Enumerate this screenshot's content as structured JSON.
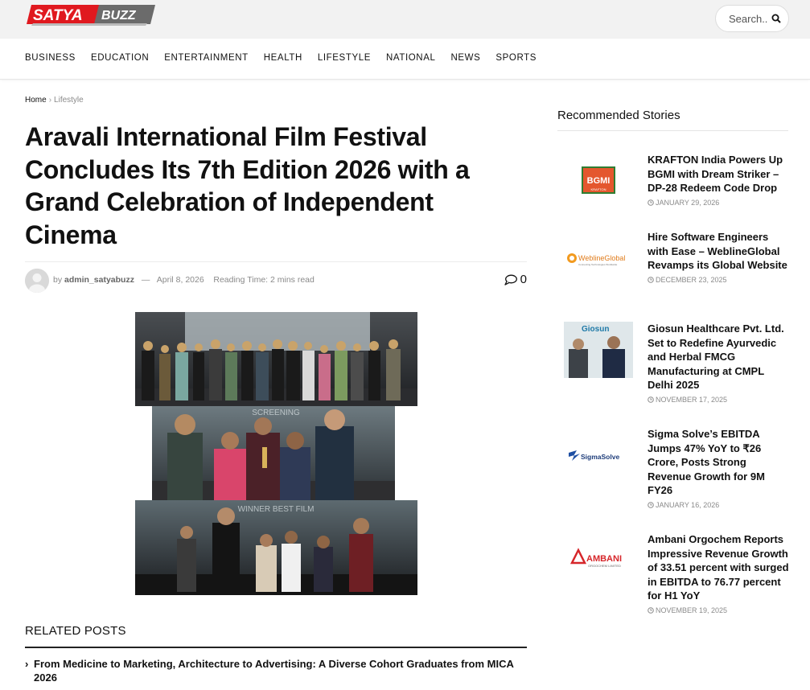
{
  "brand": {
    "logo_left": "SATYA",
    "logo_right": "BUZZ",
    "accent_red": "#e0191f",
    "accent_dark": "#555555"
  },
  "search": {
    "label": "Search..",
    "icon": "search-icon"
  },
  "nav": {
    "items": [
      "BUSINESS",
      "EDUCATION",
      "ENTERTAINMENT",
      "HEALTH",
      "LIFESTYLE",
      "NATIONAL",
      "NEWS",
      "SPORTS"
    ]
  },
  "breadcrumb": {
    "home": "Home",
    "separator": "›",
    "current": "Lifestyle"
  },
  "article": {
    "title": "Aravali International Film Festival Concludes Its 7th Edition 2026 with a Grand Celebration of Independent Cinema",
    "by": "by",
    "author": "admin_satyabuzz",
    "dash": "—",
    "date": "April 8, 2026",
    "reading_time": "Reading Time: 2 mins read",
    "comment_count": "0",
    "collage_banner_mid": "SCREENING",
    "collage_banner_bottom": "WINNER  BEST FILM"
  },
  "related": {
    "heading": "RELATED POSTS",
    "items": [
      {
        "title": "From Medicine to Marketing, Architecture to Advertising: A Diverse Cohort Graduates from MICA 2026"
      }
    ]
  },
  "sidebar": {
    "heading": "Recommended Stories",
    "stories": [
      {
        "title": "KRAFTON India Powers Up BGMI with Dream Striker – DP-28 Redeem Code Drop",
        "date": "JANUARY 29, 2026",
        "thumb_text": "BGMI",
        "thumb_sub": "KRAFTON"
      },
      {
        "title": "Hire Software Engineers with Ease – WeblineGlobal Revamps its Global Website",
        "date": "DECEMBER 23, 2025",
        "thumb_text": "WeblineGlobal",
        "thumb_sub": "Connecting Technologies Worldwide"
      },
      {
        "title": "Giosun Healthcare Pvt. Ltd. Set to Redefine Ayurvedic and Herbal FMCG Manufacturing at CMPL Delhi 2025",
        "date": "NOVEMBER 17, 2025",
        "thumb_text": "Giosun"
      },
      {
        "title": "Sigma Solve’s EBITDA Jumps 47% YoY to ₹26 Crore, Posts Strong Revenue Growth for 9M FY26",
        "date": "JANUARY 16, 2026",
        "thumb_text": "SigmaSolve"
      },
      {
        "title": "Ambani Orgochem Reports Impressive Revenue Growth of 33.51 percent with surged in EBITDA to 76.77 percent for H1 YoY",
        "date": "NOVEMBER 19, 2025",
        "thumb_text": "AMBANI",
        "thumb_sub": "ORGOCHEM LIMITED"
      }
    ]
  }
}
